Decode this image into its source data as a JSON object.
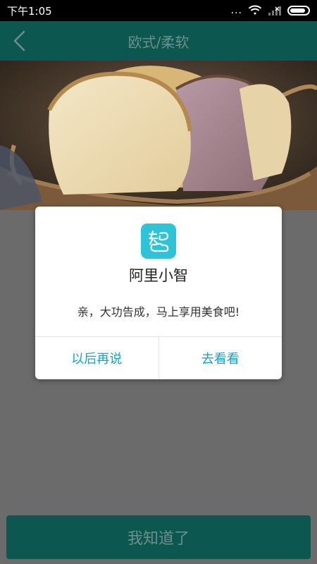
{
  "status_bar": {
    "time": "下午1:05",
    "dots": "..."
  },
  "header": {
    "title": "欧式/柔软"
  },
  "dialog": {
    "app_name": "阿里小智",
    "icon_glyph": "智",
    "message": "亲，大功告成，马上享用美食吧!",
    "cancel_label": "以后再说",
    "confirm_label": "去看看"
  },
  "bottom_button": {
    "label": "我知道了"
  },
  "colors": {
    "header_bg": "#0c5750",
    "dim_overlay": "#6b6b6b",
    "accent_text": "#1aa3c2",
    "app_icon_bg": "#2ec3d7"
  },
  "icons": [
    "back-arrow-icon",
    "wifi-icon",
    "signal-icon",
    "battery-icon",
    "app-logo-icon"
  ]
}
